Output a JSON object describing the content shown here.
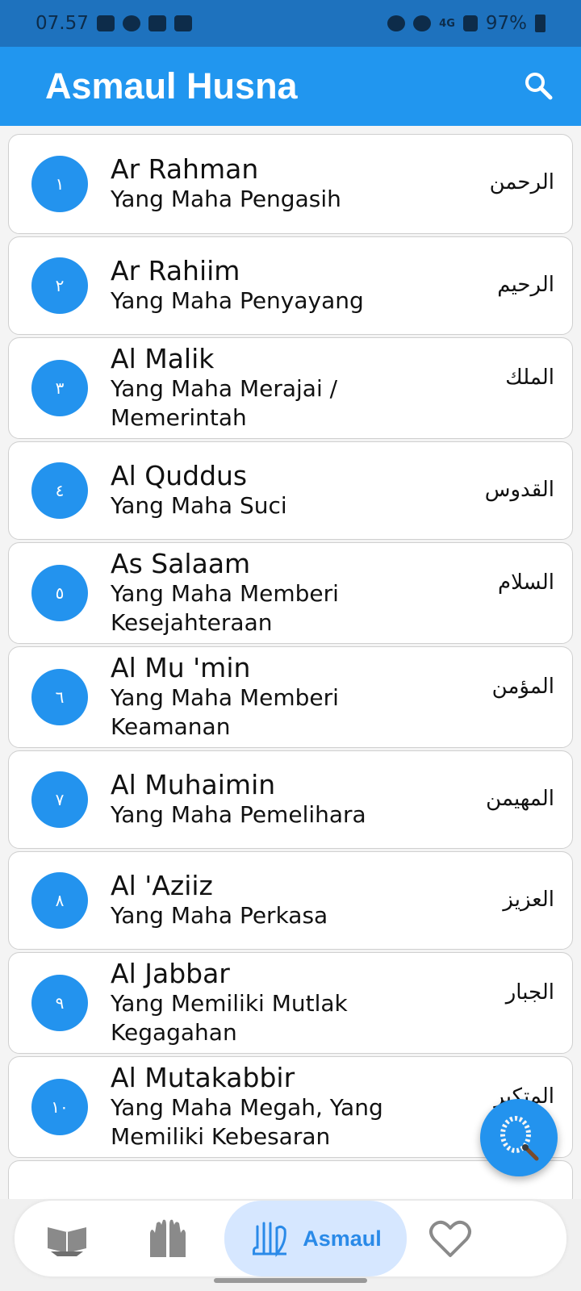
{
  "status_bar": {
    "time": "07.57",
    "battery": "97%",
    "network": "4G"
  },
  "app_bar": {
    "title": "Asmaul Husna",
    "search_icon": "search-icon"
  },
  "names": [
    {
      "number": "١",
      "latin": "Ar Rahman",
      "meaning": "Yang Maha Pengasih",
      "arabic": "الرحمن"
    },
    {
      "number": "٢",
      "latin": "Ar Rahiim",
      "meaning": "Yang Maha Penyayang",
      "arabic": "الرحيم"
    },
    {
      "number": "٣",
      "latin": "Al Malik",
      "meaning": "Yang Maha Merajai / Memerintah",
      "arabic": "الملك"
    },
    {
      "number": "٤",
      "latin": "Al Quddus",
      "meaning": "Yang Maha Suci",
      "arabic": "القدوس"
    },
    {
      "number": "٥",
      "latin": "As Salaam",
      "meaning": "Yang Maha Memberi Kesejahteraan",
      "arabic": "السلام"
    },
    {
      "number": "٦",
      "latin": "Al Mu 'min",
      "meaning": "Yang Maha Memberi Keamanan",
      "arabic": "المؤمن"
    },
    {
      "number": "٧",
      "latin": "Al Muhaimin",
      "meaning": "Yang Maha Pemelihara",
      "arabic": "المهيمن"
    },
    {
      "number": "٨",
      "latin": "Al 'Aziiz",
      "meaning": "Yang Maha Perkasa",
      "arabic": "العزيز"
    },
    {
      "number": "٩",
      "latin": "Al Jabbar",
      "meaning": "Yang Memiliki Mutlak Kegagahan",
      "arabic": "الجبار"
    },
    {
      "number": "١٠",
      "latin": "Al Mutakabbir",
      "meaning": "Yang Maha Megah, Yang Memiliki Kebesaran",
      "arabic": "المتكبر"
    }
  ],
  "fab": {
    "icon": "tasbih-icon"
  },
  "bottom_nav": {
    "items": [
      {
        "icon": "quran-icon",
        "label": ""
      },
      {
        "icon": "praying-hands-icon",
        "label": ""
      },
      {
        "icon": "allah-calligraphy-icon",
        "label": "Asmaul"
      },
      {
        "icon": "heart-icon",
        "label": ""
      }
    ]
  },
  "colors": {
    "primary": "#2196ef",
    "status_bar": "#1e72be",
    "circle": "#2393ee",
    "active_nav_bg": "#d6e7ff"
  }
}
